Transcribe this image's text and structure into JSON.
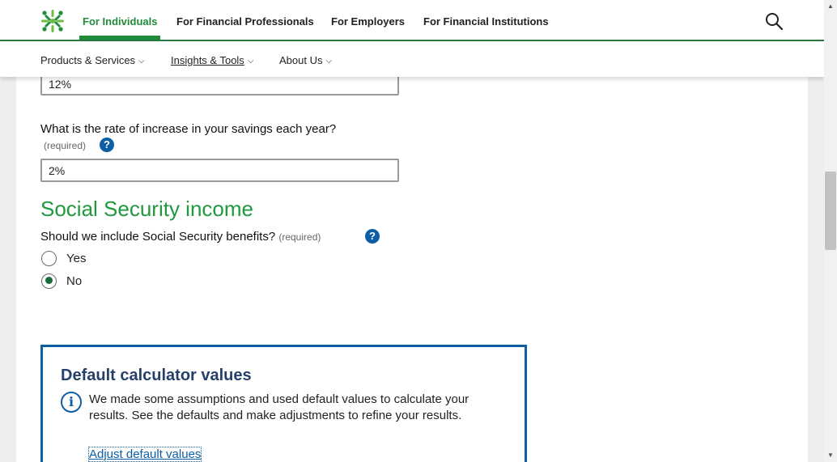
{
  "topnav": {
    "links": [
      "For Individuals",
      "For Financial Professionals",
      "For Employers",
      "For Financial Institutions"
    ]
  },
  "subnav": {
    "items": [
      "Products & Services",
      "Insights & Tools",
      "About Us"
    ]
  },
  "form": {
    "prev_field_value": "12%",
    "savings_increase": {
      "question": "What is the rate of increase in your savings each year?",
      "required": "(required)",
      "value": "2%"
    },
    "social_security": {
      "heading": "Social Security income",
      "question": "Should we include Social Security benefits?",
      "required": "(required)",
      "options": [
        "Yes",
        "No"
      ],
      "selected": "No"
    }
  },
  "info_box": {
    "title": "Default calculator values",
    "text": "We made some assumptions and used default values to calculate your results. See the defaults and make adjustments to refine your results.",
    "link": "Adjust default values"
  },
  "colors": {
    "brand_green": "#1e8c3a",
    "heading_green": "#1e9a3d",
    "link_blue": "#0d5fa5",
    "title_navy": "#27406b"
  }
}
